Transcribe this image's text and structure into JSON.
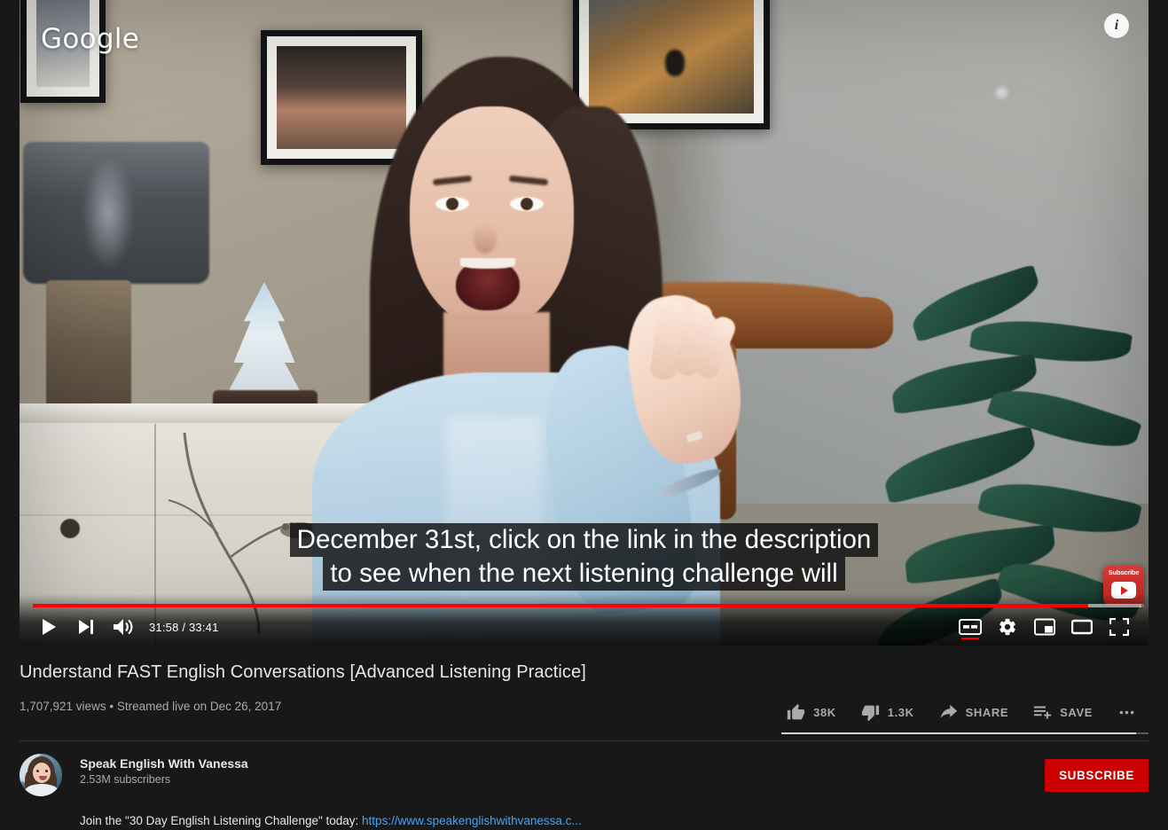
{
  "player": {
    "watermark": "Google",
    "info_icon": "i",
    "branding_watermark": {
      "label": "Subscribe",
      "icon": "youtube-play-icon"
    },
    "captions": [
      "December 31st, click on the link in the description",
      "to see when the next listening challenge will"
    ],
    "controls": {
      "play_label": "play-button",
      "next_label": "next-video-button",
      "volume_label": "volume-button",
      "time": "31:58 / 33:41",
      "current_time": "31:58",
      "duration": "33:41",
      "captions_label": "CC",
      "captions_active": true,
      "settings_label": "settings-gear",
      "miniplayer_label": "miniplayer",
      "theater_label": "theater-mode",
      "fullscreen_label": "fullscreen"
    },
    "progress": {
      "played_percent": 95.0,
      "loaded_percent": 99.8
    }
  },
  "video": {
    "title": "Understand FAST English Conversations [Advanced Listening Practice]",
    "views": "1,707,921 views",
    "separator": "•",
    "published": "Streamed live on Dec 26, 2017"
  },
  "actions": [
    {
      "name": "like",
      "icon": "thumbs-up-icon",
      "label": "38K"
    },
    {
      "name": "dislike",
      "icon": "thumbs-down-icon",
      "label": "1.3K"
    },
    {
      "name": "share",
      "icon": "share-arrow-icon",
      "label": "SHARE"
    },
    {
      "name": "save",
      "icon": "save-playlist-icon",
      "label": "SAVE"
    },
    {
      "name": "more",
      "icon": "more-horizontal-icon",
      "label": ""
    }
  ],
  "like_ratio_percent": 96.6,
  "channel": {
    "avatar": "channel-avatar",
    "name": "Speak English With Vanessa",
    "subscribers": "2.53M subscribers",
    "subscribe_label": "SUBSCRIBE"
  },
  "description": {
    "text": "Join the \"30 Day English Listening Challenge\" today: ",
    "link": "https://www.speakenglishwithvanessa.c..."
  },
  "colors": {
    "accent_red": "#ff0000",
    "subscribe_red": "#cc0000",
    "link_blue": "#3ea6ff",
    "page_bg": "#181818",
    "primary_text": "#e8e8e8",
    "secondary_text": "#aaaaaa"
  }
}
